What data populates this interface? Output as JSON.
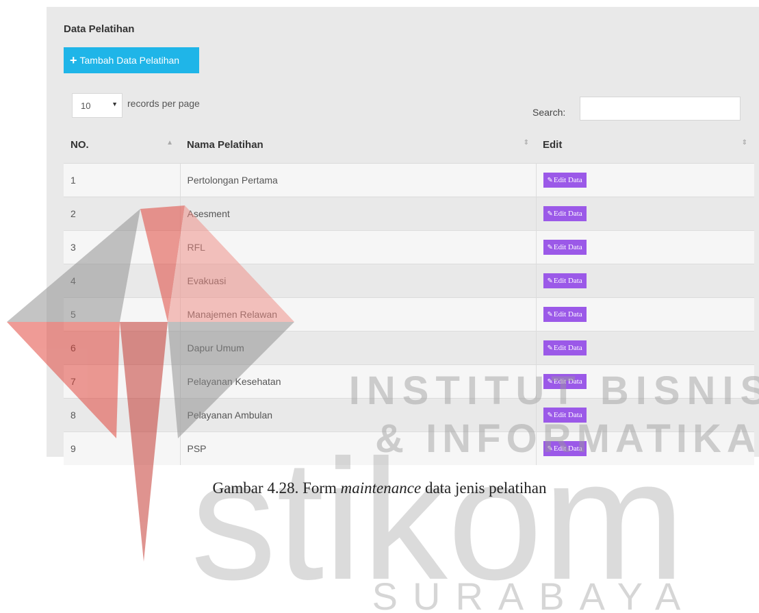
{
  "panel": {
    "title": "Data Pelatihan",
    "add_button": "Tambah Data Pelatihan",
    "add_icon": "+",
    "length_value": "10",
    "length_suffix": "records per page",
    "search_label": "Search:",
    "search_value": ""
  },
  "table": {
    "headers": [
      "NO.",
      "Nama Pelatihan",
      "Edit"
    ],
    "edit_label": "Edit Data",
    "rows": [
      {
        "no": "1",
        "name": "Pertolongan Pertama"
      },
      {
        "no": "2",
        "name": "Asesment"
      },
      {
        "no": "3",
        "name": "RFL"
      },
      {
        "no": "4",
        "name": "Evakuasi"
      },
      {
        "no": "5",
        "name": "Manajemen Relawan"
      },
      {
        "no": "6",
        "name": "Dapur Umum"
      },
      {
        "no": "7",
        "name": "Pelayanan Kesehatan"
      },
      {
        "no": "8",
        "name": "Pelayanan Ambulan"
      },
      {
        "no": "9",
        "name": "PSP"
      }
    ]
  },
  "caption": {
    "prefix": "Gambar 4.28. Form ",
    "italic": "maintenance",
    "suffix": " data jenis pelatihan"
  },
  "watermark": {
    "line1": "INSTITUT BISNIS",
    "line2": "& INFORMATIKA",
    "big": "stikom",
    "city": "SURABAYA"
  },
  "colors": {
    "add_button": "#1fb5e8",
    "edit_button": "#9b59e8",
    "watermark_red": "#e03a2f"
  }
}
